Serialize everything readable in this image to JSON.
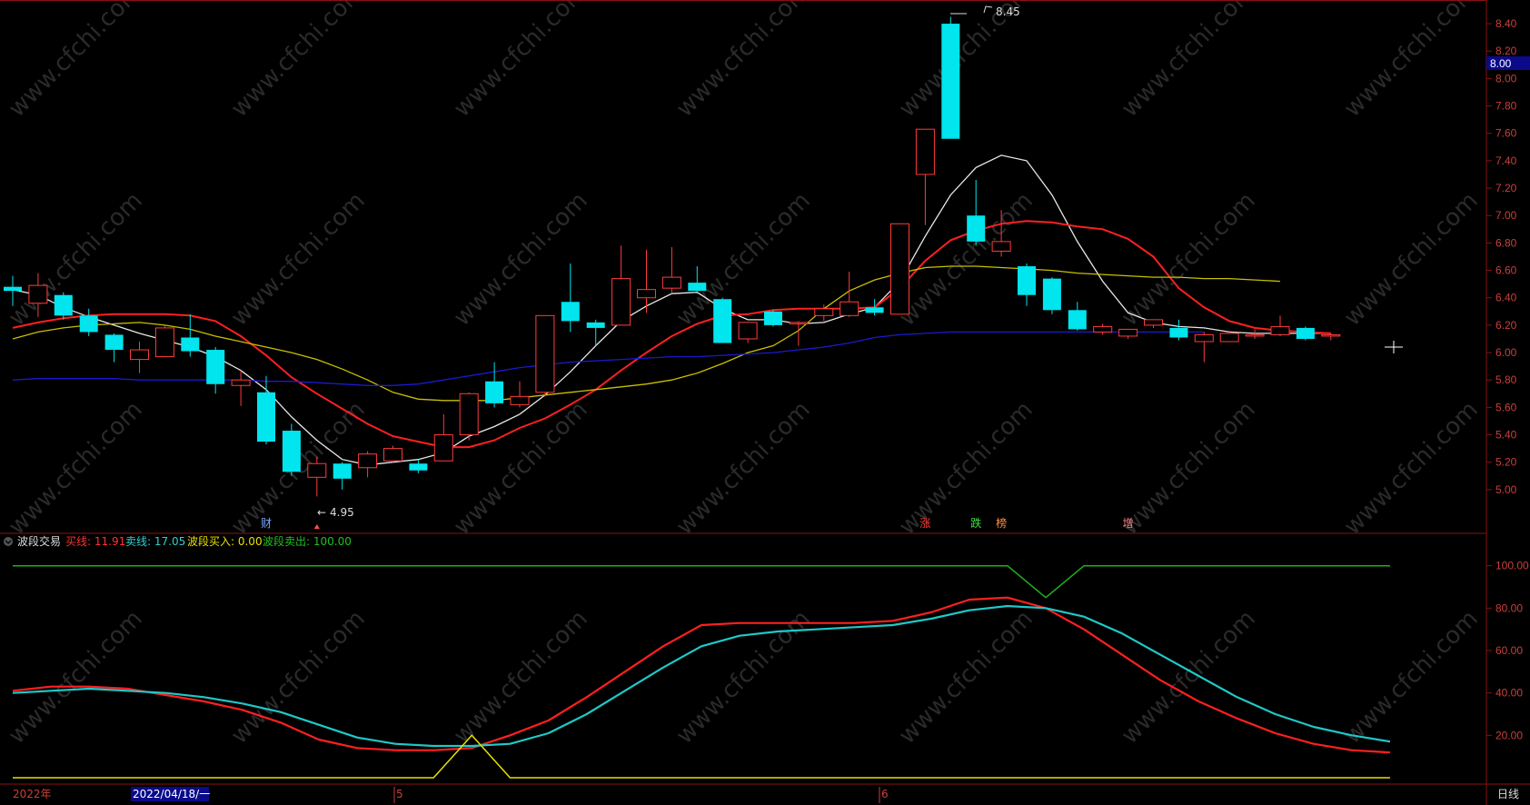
{
  "chart_data": [
    {
      "type": "candlestick",
      "price_range": [
        4.86,
        8.48
      ],
      "price_ticks": [
        "5.00",
        "5.20",
        "5.40",
        "5.60",
        "5.80",
        "6.00",
        "6.20",
        "6.40",
        "6.60",
        "6.80",
        "7.00",
        "7.20",
        "7.40",
        "7.60",
        "7.80",
        "8.00",
        "8.20",
        "8.40"
      ],
      "current_price_label": "8.00",
      "candles": [
        {
          "o": 6.45,
          "c": 6.48,
          "h": 6.56,
          "l": 6.34,
          "dir": "down"
        },
        {
          "o": 6.36,
          "c": 6.49,
          "h": 6.58,
          "l": 6.26,
          "dir": "up"
        },
        {
          "o": 6.42,
          "c": 6.27,
          "h": 6.44,
          "l": 6.24,
          "dir": "down"
        },
        {
          "o": 6.27,
          "c": 6.15,
          "h": 6.32,
          "l": 6.12,
          "dir": "down"
        },
        {
          "o": 6.13,
          "c": 6.02,
          "h": 6.14,
          "l": 5.93,
          "dir": "down"
        },
        {
          "o": 5.95,
          "c": 6.02,
          "h": 6.08,
          "l": 5.85,
          "dir": "up"
        },
        {
          "o": 5.97,
          "c": 6.18,
          "h": 6.2,
          "l": 5.97,
          "dir": "up"
        },
        {
          "o": 6.11,
          "c": 6.01,
          "h": 6.28,
          "l": 5.97,
          "dir": "down"
        },
        {
          "o": 6.02,
          "c": 5.77,
          "h": 6.04,
          "l": 5.7,
          "dir": "down"
        },
        {
          "o": 5.76,
          "c": 5.8,
          "h": 5.87,
          "l": 5.61,
          "dir": "up"
        },
        {
          "o": 5.71,
          "c": 5.35,
          "h": 5.83,
          "l": 5.33,
          "dir": "down"
        },
        {
          "o": 5.43,
          "c": 5.13,
          "h": 5.48,
          "l": 5.1,
          "dir": "down"
        },
        {
          "o": 5.09,
          "c": 5.19,
          "h": 5.24,
          "l": 4.95,
          "dir": "up"
        },
        {
          "o": 5.19,
          "c": 5.08,
          "h": 5.2,
          "l": 5.0,
          "dir": "down"
        },
        {
          "o": 5.16,
          "c": 5.26,
          "h": 5.28,
          "l": 5.09,
          "dir": "up"
        },
        {
          "o": 5.21,
          "c": 5.3,
          "h": 5.32,
          "l": 5.2,
          "dir": "up"
        },
        {
          "o": 5.19,
          "c": 5.14,
          "h": 5.22,
          "l": 5.12,
          "dir": "down"
        },
        {
          "o": 5.21,
          "c": 5.4,
          "h": 5.55,
          "l": 5.21,
          "dir": "up"
        },
        {
          "o": 5.4,
          "c": 5.7,
          "h": 5.71,
          "l": 5.36,
          "dir": "up"
        },
        {
          "o": 5.79,
          "c": 5.63,
          "h": 5.93,
          "l": 5.6,
          "dir": "down"
        },
        {
          "o": 5.62,
          "c": 5.68,
          "h": 5.79,
          "l": 5.6,
          "dir": "up"
        },
        {
          "o": 5.71,
          "c": 6.27,
          "h": 6.27,
          "l": 5.68,
          "dir": "up"
        },
        {
          "o": 6.37,
          "c": 6.23,
          "h": 6.65,
          "l": 6.15,
          "dir": "down"
        },
        {
          "o": 6.22,
          "c": 6.18,
          "h": 6.24,
          "l": 6.05,
          "dir": "down"
        },
        {
          "o": 6.2,
          "c": 6.54,
          "h": 6.78,
          "l": 6.2,
          "dir": "up"
        },
        {
          "o": 6.4,
          "c": 6.46,
          "h": 6.75,
          "l": 6.29,
          "dir": "up"
        },
        {
          "o": 6.47,
          "c": 6.55,
          "h": 6.77,
          "l": 6.43,
          "dir": "up"
        },
        {
          "o": 6.51,
          "c": 6.45,
          "h": 6.63,
          "l": 6.43,
          "dir": "down"
        },
        {
          "o": 6.39,
          "c": 6.07,
          "h": 6.4,
          "l": 6.07,
          "dir": "down"
        },
        {
          "o": 6.1,
          "c": 6.22,
          "h": 6.22,
          "l": 6.07,
          "dir": "up"
        },
        {
          "o": 6.3,
          "c": 6.2,
          "h": 6.31,
          "l": 6.19,
          "dir": "down"
        },
        {
          "o": 6.21,
          "c": 6.22,
          "h": 6.23,
          "l": 6.05,
          "dir": "up"
        },
        {
          "o": 6.27,
          "c": 6.32,
          "h": 6.35,
          "l": 6.23,
          "dir": "up"
        },
        {
          "o": 6.27,
          "c": 6.37,
          "h": 6.59,
          "l": 6.26,
          "dir": "up"
        },
        {
          "o": 6.33,
          "c": 6.29,
          "h": 6.39,
          "l": 6.27,
          "dir": "down"
        },
        {
          "o": 6.28,
          "c": 6.94,
          "h": 6.94,
          "l": 6.28,
          "dir": "up"
        },
        {
          "o": 7.3,
          "c": 7.63,
          "h": 7.63,
          "l": 6.93,
          "dir": "up"
        },
        {
          "o": 8.4,
          "c": 7.56,
          "h": 8.45,
          "l": 7.56,
          "dir": "down"
        },
        {
          "o": 7.0,
          "c": 6.81,
          "h": 7.26,
          "l": 6.78,
          "dir": "down"
        },
        {
          "o": 6.74,
          "c": 6.81,
          "h": 7.04,
          "l": 6.7,
          "dir": "up"
        },
        {
          "o": 6.63,
          "c": 6.42,
          "h": 6.65,
          "l": 6.34,
          "dir": "down"
        },
        {
          "o": 6.54,
          "c": 6.31,
          "h": 6.55,
          "l": 6.28,
          "dir": "down"
        },
        {
          "o": 6.31,
          "c": 6.17,
          "h": 6.37,
          "l": 6.16,
          "dir": "down"
        },
        {
          "o": 6.15,
          "c": 6.19,
          "h": 6.21,
          "l": 6.13,
          "dir": "up"
        },
        {
          "o": 6.12,
          "c": 6.17,
          "h": 6.17,
          "l": 6.1,
          "dir": "up"
        },
        {
          "o": 6.2,
          "c": 6.24,
          "h": 6.24,
          "l": 6.18,
          "dir": "up"
        },
        {
          "o": 6.18,
          "c": 6.11,
          "h": 6.24,
          "l": 6.09,
          "dir": "down"
        },
        {
          "o": 6.08,
          "c": 6.13,
          "h": 6.15,
          "l": 5.93,
          "dir": "up"
        },
        {
          "o": 6.08,
          "c": 6.14,
          "h": 6.16,
          "l": 6.08,
          "dir": "up"
        },
        {
          "o": 6.12,
          "c": 6.13,
          "h": 6.17,
          "l": 6.1,
          "dir": "up"
        },
        {
          "o": 6.13,
          "c": 6.19,
          "h": 6.27,
          "l": 6.12,
          "dir": "up"
        },
        {
          "o": 6.18,
          "c": 6.1,
          "h": 6.19,
          "l": 6.09,
          "dir": "down"
        },
        {
          "o": 6.12,
          "c": 6.13,
          "h": 6.14,
          "l": 6.09,
          "dir": "up"
        }
      ],
      "ma_lines": [
        {
          "color": "#e8e8e8",
          "values": [
            6.46,
            6.42,
            6.33,
            6.26,
            6.2,
            6.14,
            6.09,
            6.04,
            5.97,
            5.87,
            5.73,
            5.53,
            5.36,
            5.22,
            5.18,
            5.2,
            5.22,
            5.27,
            5.39,
            5.46,
            5.55,
            5.69,
            5.86,
            6.05,
            6.23,
            6.34,
            6.43,
            6.44,
            6.32,
            6.24,
            6.24,
            6.21,
            6.22,
            6.28,
            6.33,
            6.52,
            6.85,
            7.15,
            7.35,
            7.44,
            7.4,
            7.15,
            6.81,
            6.52,
            6.29,
            6.22,
            6.19,
            6.18,
            6.15,
            6.14,
            6.14,
            6.14,
            6.14
          ]
        },
        {
          "color": "#ff2020",
          "values": [
            6.18,
            6.22,
            6.25,
            6.27,
            6.28,
            6.28,
            6.28,
            6.27,
            6.23,
            6.12,
            5.98,
            5.82,
            5.7,
            5.59,
            5.48,
            5.39,
            5.35,
            5.31,
            5.31,
            5.36,
            5.45,
            5.52,
            5.62,
            5.73,
            5.87,
            6.0,
            6.12,
            6.21,
            6.27,
            6.28,
            6.31,
            6.32,
            6.32,
            6.32,
            6.33,
            6.47,
            6.67,
            6.82,
            6.89,
            6.94,
            6.96,
            6.95,
            6.92,
            6.9,
            6.83,
            6.7,
            6.47,
            6.33,
            6.23,
            6.18,
            6.16,
            6.15,
            6.14
          ]
        },
        {
          "color": "#c8c000",
          "values": [
            6.1,
            6.15,
            6.18,
            6.2,
            6.21,
            6.22,
            6.2,
            6.17,
            6.12,
            6.08,
            6.04,
            6.0,
            5.95,
            5.88,
            5.8,
            5.71,
            5.66,
            5.65,
            5.65,
            5.65,
            5.67,
            5.69,
            5.71,
            5.73,
            5.75,
            5.77,
            5.8,
            5.85,
            5.92,
            6.0,
            6.05,
            6.16,
            6.32,
            6.45,
            6.53,
            6.58,
            6.62,
            6.63,
            6.63,
            6.62,
            6.61,
            6.6,
            6.58,
            6.57,
            6.56,
            6.55,
            6.55,
            6.54,
            6.54,
            6.53,
            6.52
          ]
        },
        {
          "color": "#1a1ad0",
          "values": [
            5.8,
            5.81,
            5.81,
            5.81,
            5.81,
            5.8,
            5.8,
            5.8,
            5.8,
            5.8,
            5.79,
            5.79,
            5.78,
            5.77,
            5.76,
            5.76,
            5.77,
            5.8,
            5.83,
            5.86,
            5.89,
            5.91,
            5.93,
            5.94,
            5.95,
            5.96,
            5.97,
            5.97,
            5.98,
            5.99,
            6.0,
            6.02,
            6.04,
            6.07,
            6.11,
            6.13,
            6.14,
            6.15,
            6.15,
            6.15,
            6.15,
            6.15,
            6.15,
            6.15,
            6.15,
            6.15,
            6.15,
            6.15
          ]
        }
      ],
      "annotations": {
        "high_label": "8.45",
        "low_label": "4.95"
      },
      "event_markers": [
        {
          "text": "财",
          "color": "#7aa8ff",
          "candle": 10
        },
        {
          "text": "涨",
          "color": "#ff4040",
          "candle": 36
        },
        {
          "text": "跌",
          "color": "#40e040",
          "candle": 38
        },
        {
          "text": "榜",
          "color": "#ff9040",
          "candle": 39
        },
        {
          "text": "增",
          "color": "#ff8080",
          "candle": 44
        }
      ]
    },
    {
      "type": "line",
      "title": "波段交易",
      "legend": [
        {
          "label": "买线: 11.91",
          "color": "#ff3030"
        },
        {
          "label": "卖线: 17.05",
          "color": "#30d0d0"
        },
        {
          "label": "波段买入: 0.00",
          "color": "#e8e000"
        },
        {
          "label": "波段卖出: 100.00",
          "color": "#20c020"
        }
      ],
      "ylim": [
        0,
        105
      ],
      "y_ticks": [
        "20.00",
        "40.00",
        "60.00",
        "80.00",
        "100.00"
      ],
      "series": [
        {
          "name": "买线",
          "color": "#ff2020",
          "values": [
            41,
            43,
            43,
            42,
            39,
            36,
            32,
            26,
            18,
            14,
            13,
            13,
            14,
            20,
            27,
            38,
            50,
            62,
            72,
            73,
            73,
            73,
            73,
            74,
            78,
            84,
            85,
            80,
            70,
            58,
            46,
            36,
            28,
            21,
            16,
            13,
            11.91
          ]
        },
        {
          "name": "卖线",
          "color": "#20c8c8",
          "values": [
            40,
            41,
            42,
            41,
            40,
            38,
            35,
            31,
            25,
            19,
            16,
            15,
            15,
            16,
            21,
            30,
            41,
            52,
            62,
            67,
            69,
            70,
            71,
            72,
            75,
            79,
            81,
            80,
            76,
            68,
            58,
            48,
            38,
            30,
            24,
            20,
            17.05
          ]
        },
        {
          "name": "波段买入",
          "color": "#e8e000",
          "values": [
            0,
            0,
            0,
            0,
            0,
            0,
            0,
            0,
            0,
            0,
            0,
            0,
            20,
            0,
            0,
            0,
            0,
            0,
            0,
            0,
            0,
            0,
            0,
            0,
            0,
            0,
            0,
            0,
            0,
            0,
            0,
            0,
            0,
            0,
            0,
            0,
            0
          ]
        },
        {
          "name": "波段卖出",
          "color": "#20b020",
          "values": [
            100,
            100,
            100,
            100,
            100,
            100,
            100,
            100,
            100,
            100,
            100,
            100,
            100,
            100,
            100,
            100,
            100,
            100,
            100,
            100,
            100,
            100,
            100,
            100,
            100,
            100,
            100,
            85,
            100,
            100,
            100,
            100,
            100,
            100,
            100,
            100,
            100
          ]
        }
      ]
    }
  ],
  "timeline": {
    "year": "2022年",
    "cursor_date": "2022/04/18/一",
    "month_5": "5",
    "month_6": "6",
    "period": "日线"
  },
  "watermark": "www.cfchi.com"
}
